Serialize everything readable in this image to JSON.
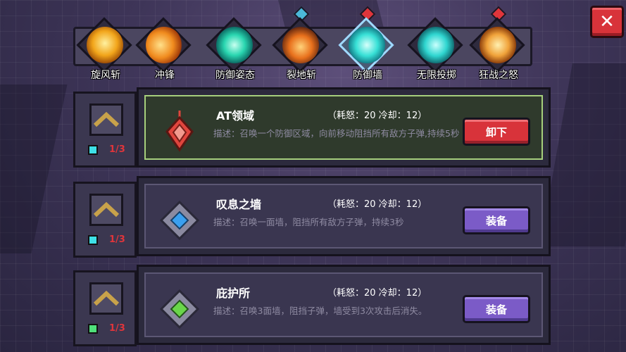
{
  "close_label": "✕",
  "skills": [
    {
      "label": "旋风斩",
      "icon": "whirlwind-icon",
      "color": "#f2a51a",
      "gem": false
    },
    {
      "label": "冲锋",
      "icon": "charge-icon",
      "color": "#f08b1e",
      "gem": false
    },
    {
      "label": "防御姿态",
      "icon": "defense-stance-icon",
      "color": "#29d6b0",
      "gem": false
    },
    {
      "label": "裂地斩",
      "icon": "ground-slash-icon",
      "color": "#e8701c",
      "gem": true,
      "gem_color": "#4bb8d8"
    },
    {
      "label": "防御墙",
      "icon": "defense-wall-icon",
      "color": "#37e0d6",
      "gem": true,
      "gem_color": "#e0353b",
      "active": true
    },
    {
      "label": "无限投掷",
      "icon": "infinite-throw-icon",
      "color": "#2fd6d0",
      "gem": false
    },
    {
      "label": "狂战之怒",
      "icon": "berserk-rage-icon",
      "color": "#f0a23a",
      "gem": true,
      "gem_color": "#e0353b"
    }
  ],
  "items": [
    {
      "name": "AT领域",
      "stats": "（耗怒：20  冷却：12）",
      "desc": "描述：召唤一个防御区域，向前移动阻挡所有敌方子弹,持续5秒",
      "button": "卸下",
      "count": "1/3",
      "gem_color": "#3ee0e6",
      "icon_color": "#e0453d",
      "equipped": true
    },
    {
      "name": "叹息之墙",
      "stats": "（耗怒：20  冷却：12）",
      "desc": "描述：召唤一面墙，阻挡所有敌方子弹，持续3秒",
      "button": "装备",
      "count": "1/3",
      "gem_color": "#3ee0e6",
      "icon_color": "#3aa0f0",
      "equipped": false
    },
    {
      "name": "庇护所",
      "stats": "（耗怒：20  冷却：12）",
      "desc": "描述：召唤3面墙，阻挡子弹，墙受到3次攻击后消失。",
      "button": "装备",
      "count": "1/3",
      "gem_color": "#4fe07a",
      "icon_color": "#6ad64a",
      "equipped": false
    }
  ]
}
